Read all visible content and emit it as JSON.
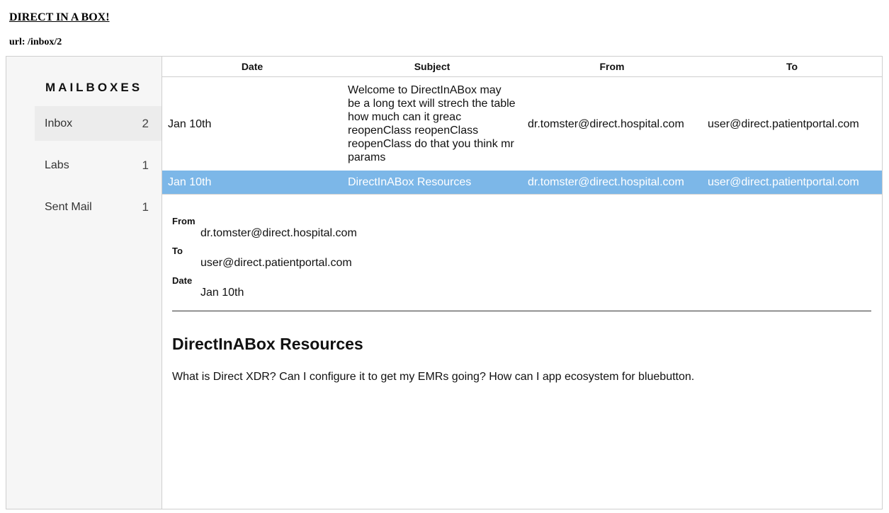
{
  "app": {
    "title": "DIRECT IN A BOX!",
    "url_line": "url: /inbox/2"
  },
  "sidebar": {
    "title": "MAILBOXES",
    "items": [
      {
        "label": "Inbox",
        "count": "2"
      },
      {
        "label": "Labs",
        "count": "1"
      },
      {
        "label": "Sent Mail",
        "count": "1"
      }
    ]
  },
  "table": {
    "headers": {
      "date": "Date",
      "subject": "Subject",
      "from": "From",
      "to": "To"
    },
    "rows": [
      {
        "date": "Jan 10th",
        "subject": "Welcome to DirectInABox may be a long text will strech the table how much can it greac reopenClass reopenClass reopenClass do that you think mr params",
        "from": "dr.tomster@direct.hospital.com",
        "to": "user@direct.patientportal.com"
      },
      {
        "date": "Jan 10th",
        "subject": "DirectInABox Resources",
        "from": "dr.tomster@direct.hospital.com",
        "to": "user@direct.patientportal.com"
      }
    ]
  },
  "message": {
    "from_label": "From",
    "from_value": "dr.tomster@direct.hospital.com",
    "to_label": "To",
    "to_value": "user@direct.patientportal.com",
    "date_label": "Date",
    "date_value": "Jan 10th",
    "subject": "DirectInABox Resources",
    "body": "What is Direct XDR? Can I configure it to get my EMRs going? How can I app ecosystem for bluebutton."
  },
  "colors": {
    "selected_row": "#7cb7e8",
    "sidebar_bg": "#f6f6f6",
    "active_item_bg": "#ececec"
  }
}
